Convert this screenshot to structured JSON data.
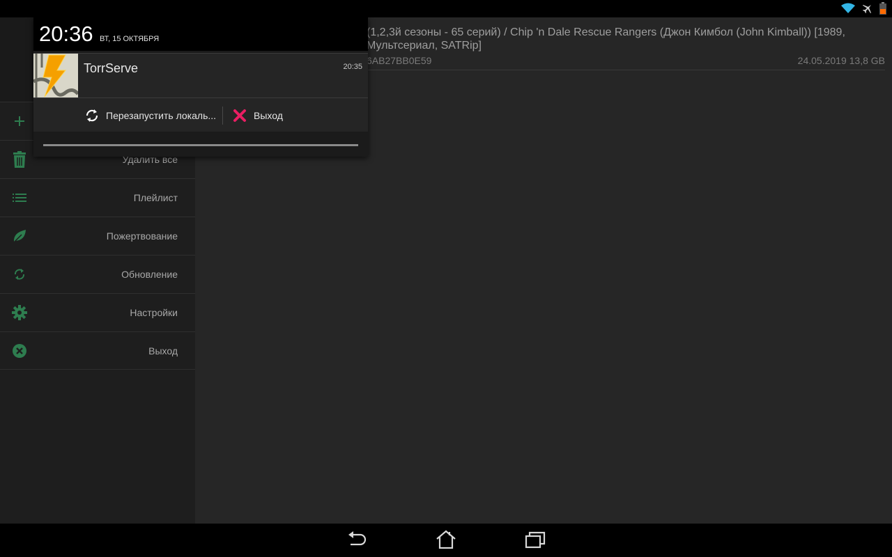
{
  "status_bar": {
    "icons": [
      "wifi-icon",
      "airplane-mode-icon",
      "battery-icon"
    ],
    "colors": {
      "wifi": "#33b5e5",
      "battery": "#ff6a00"
    }
  },
  "drawer": {
    "items": [
      {
        "icon": "plus-icon",
        "label": ""
      },
      {
        "icon": "trash-icon",
        "label": "Удалить все"
      },
      {
        "icon": "playlist-icon",
        "label": "Плейлист"
      },
      {
        "icon": "leaf-icon",
        "label": "Пожертвование"
      },
      {
        "icon": "refresh-icon",
        "label": "Обновление"
      },
      {
        "icon": "gear-icon",
        "label": "Настройки"
      },
      {
        "icon": "close-circle-icon",
        "label": "Выход"
      }
    ],
    "icon_color": "#2e7d4f"
  },
  "torrent": {
    "title": "(1,2,3й сезоны - 65 серий) / Chip 'n Dale Rescue Rangers (Джон Кимбол (John Kimball)) [1989, Мультсериал, SATRip]",
    "hash": "6AB27BB0E59",
    "date": "24.05.2019",
    "size": "13,8 GB"
  },
  "notification_shade": {
    "time": "20:36",
    "date": "ВТ, 15 ОКТЯБРЯ",
    "notification": {
      "app_name": "TorrServe",
      "time": "20:35",
      "actions": [
        {
          "icon": "restart-icon",
          "label": "Перезапустить локаль..."
        },
        {
          "icon": "close-x-icon",
          "label": "Выход"
        }
      ]
    }
  },
  "navigation_bar": {
    "buttons": [
      "back-icon",
      "home-icon",
      "recent-apps-icon"
    ]
  }
}
